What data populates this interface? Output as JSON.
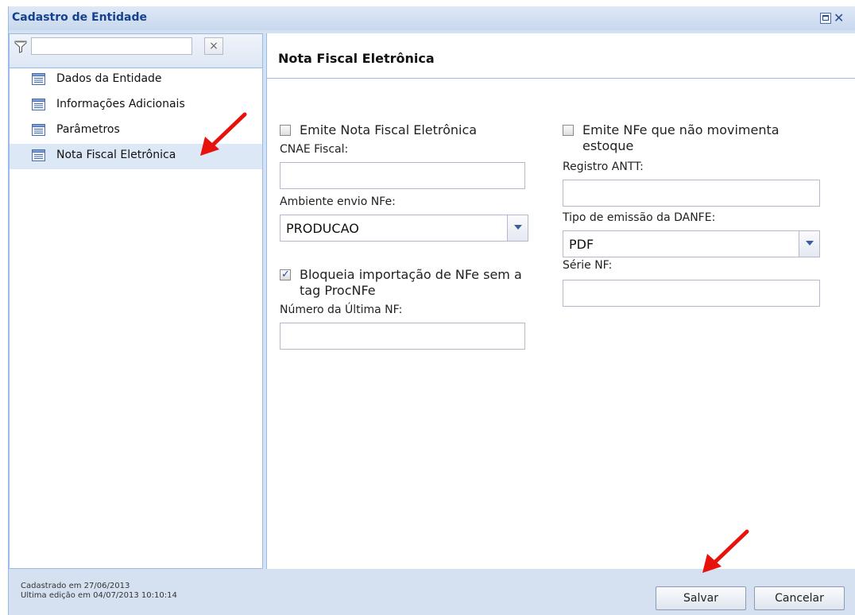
{
  "window": {
    "title": "Cadastro de Entidade"
  },
  "sidebar": {
    "filter_value": "",
    "clear_glyph": "×",
    "items": [
      {
        "label": "Dados da Entidade",
        "icon": "document-list-icon"
      },
      {
        "label": "Informações Adicionais",
        "icon": "document-list-icon"
      },
      {
        "label": "Parâmetros",
        "icon": "document-list-icon"
      },
      {
        "label": "Nota Fiscal Eletrônica",
        "icon": "document-list-icon",
        "selected": true
      }
    ]
  },
  "main": {
    "title": "Nota Fiscal Eletrônica",
    "left": {
      "emite_nfe": {
        "label": "Emite Nota Fiscal Eletrônica",
        "checked": false
      },
      "cnae": {
        "label": "CNAE Fiscal:",
        "value": ""
      },
      "ambiente": {
        "label": "Ambiente envio NFe:",
        "value": "PRODUCAO"
      },
      "bloqueia": {
        "label": "Bloqueia importação de NFe sem a tag ProcNFe",
        "checked": true
      },
      "numero_ultima": {
        "label": "Número da Última NF:",
        "value": ""
      }
    },
    "right": {
      "emite_nao_mov": {
        "label": "Emite NFe que não movimenta estoque",
        "checked": false
      },
      "antt": {
        "label": "Registro ANTT:",
        "value": ""
      },
      "tipo_danfe": {
        "label": "Tipo de emissão da DANFE:",
        "value": "PDF"
      },
      "serie": {
        "label": "Série NF:",
        "value": ""
      }
    }
  },
  "footer": {
    "created": "Cadastrado em 27/06/2013",
    "edited": "Ultima edição em 04/07/2013 10:10:14",
    "save_label": "Salvar",
    "cancel_label": "Cancelar"
  },
  "colors": {
    "accent_title": "#15428b",
    "annotation_arrow": "#e8120c",
    "panel_bg": "#d5e1f0",
    "border": "#99bbe8"
  }
}
